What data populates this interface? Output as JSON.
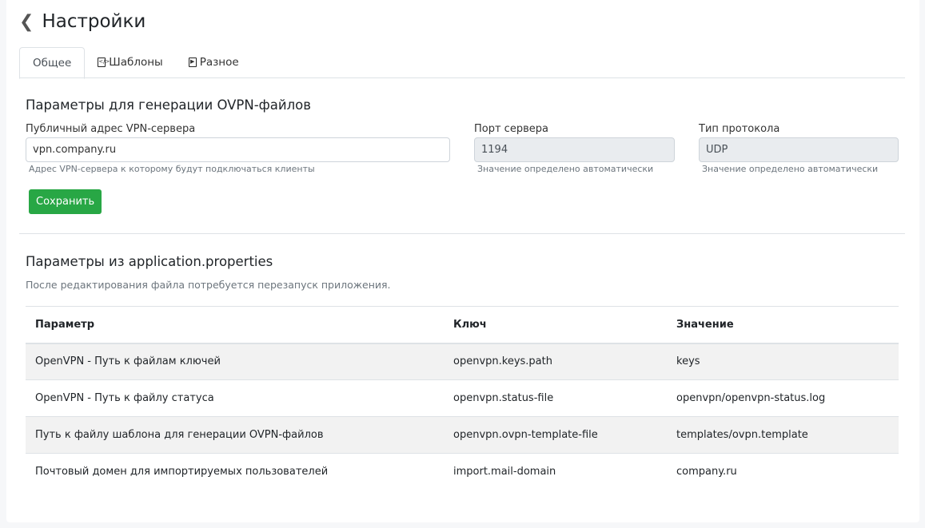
{
  "header": {
    "title": "Настройки"
  },
  "tabs": [
    {
      "label": "Общее"
    },
    {
      "label": "Шаблоны"
    },
    {
      "label": "Разное"
    }
  ],
  "ovpn": {
    "title": "Параметры для генерации OVPN-файлов",
    "address_label": "Публичный адрес VPN-сервера",
    "address_value": "vpn.company.ru",
    "address_hint": "Адрес VPN-сервера к которому будут подключаться клиенты",
    "port_label": "Порт сервера",
    "port_value": "1194",
    "port_hint": "Значение определено автоматически",
    "proto_label": "Тип протокола",
    "proto_value": "UDP",
    "proto_hint": "Значение определено автоматически",
    "save": "Сохранить"
  },
  "props": {
    "title": "Параметры из application.properties",
    "note": "После редактирования файла потребуется перезапуск приложения.",
    "columns": [
      "Параметр",
      "Ключ",
      "Значение"
    ],
    "rows": [
      [
        "OpenVPN - Путь к файлам ключей",
        "openvpn.keys.path",
        "keys"
      ],
      [
        "OpenVPN - Путь к файлу статуса",
        "openvpn.status-file",
        "openvpn/openvpn-status.log"
      ],
      [
        "Путь к файлу шаблона для генерации OVPN-файлов",
        "openvpn.ovpn-template-file",
        "templates/ovpn.template"
      ],
      [
        "Почтовый домен для импортируемых пользователей",
        "import.mail-domain",
        "company.ru"
      ]
    ]
  }
}
